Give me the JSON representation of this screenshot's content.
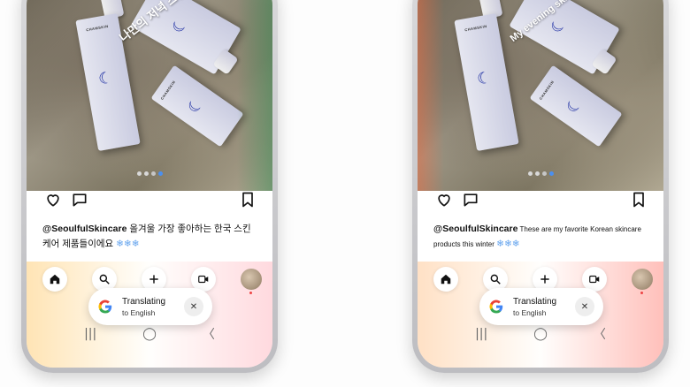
{
  "left_phone": {
    "overlay_text": "나만의 저녁 스킨",
    "brand": "CHAMSKIN",
    "caption_user": "@SeoulfulSkincare",
    "caption_body": " 올겨울 가장 좋아하는 한국 스킨케어 제품들이에요 ",
    "caption_flakes": "❄❄❄",
    "translate_title": "Translating",
    "translate_sub": "to English",
    "close_glyph": "✕"
  },
  "right_phone": {
    "overlay_text": "My evening skincare",
    "brand": "CHAMSKIN",
    "caption_user": "@SeoulfulSkincare",
    "caption_body": " These are my favorite Korean skincare products this winter ",
    "caption_flakes": "❄❄❄",
    "translate_title": "Translating",
    "translate_sub": "to English",
    "close_glyph": "✕"
  },
  "icons": {
    "like": "heart-icon",
    "comment": "comment-icon",
    "save": "bookmark-icon",
    "home": "home-icon",
    "search": "search-icon",
    "create": "plus-icon",
    "reels": "video-icon",
    "profile": "avatar",
    "recents": "recents-icon",
    "home_nav": "home-nav-icon",
    "back": "back-icon"
  },
  "nav_glyphs": {
    "recents": "|||",
    "home": "◯",
    "back": "〈"
  },
  "carousel": {
    "total": 4,
    "active_index": 4
  },
  "colors": {
    "accent_blue": "#4a8ff0",
    "flake_blue": "#6aa7ee"
  }
}
